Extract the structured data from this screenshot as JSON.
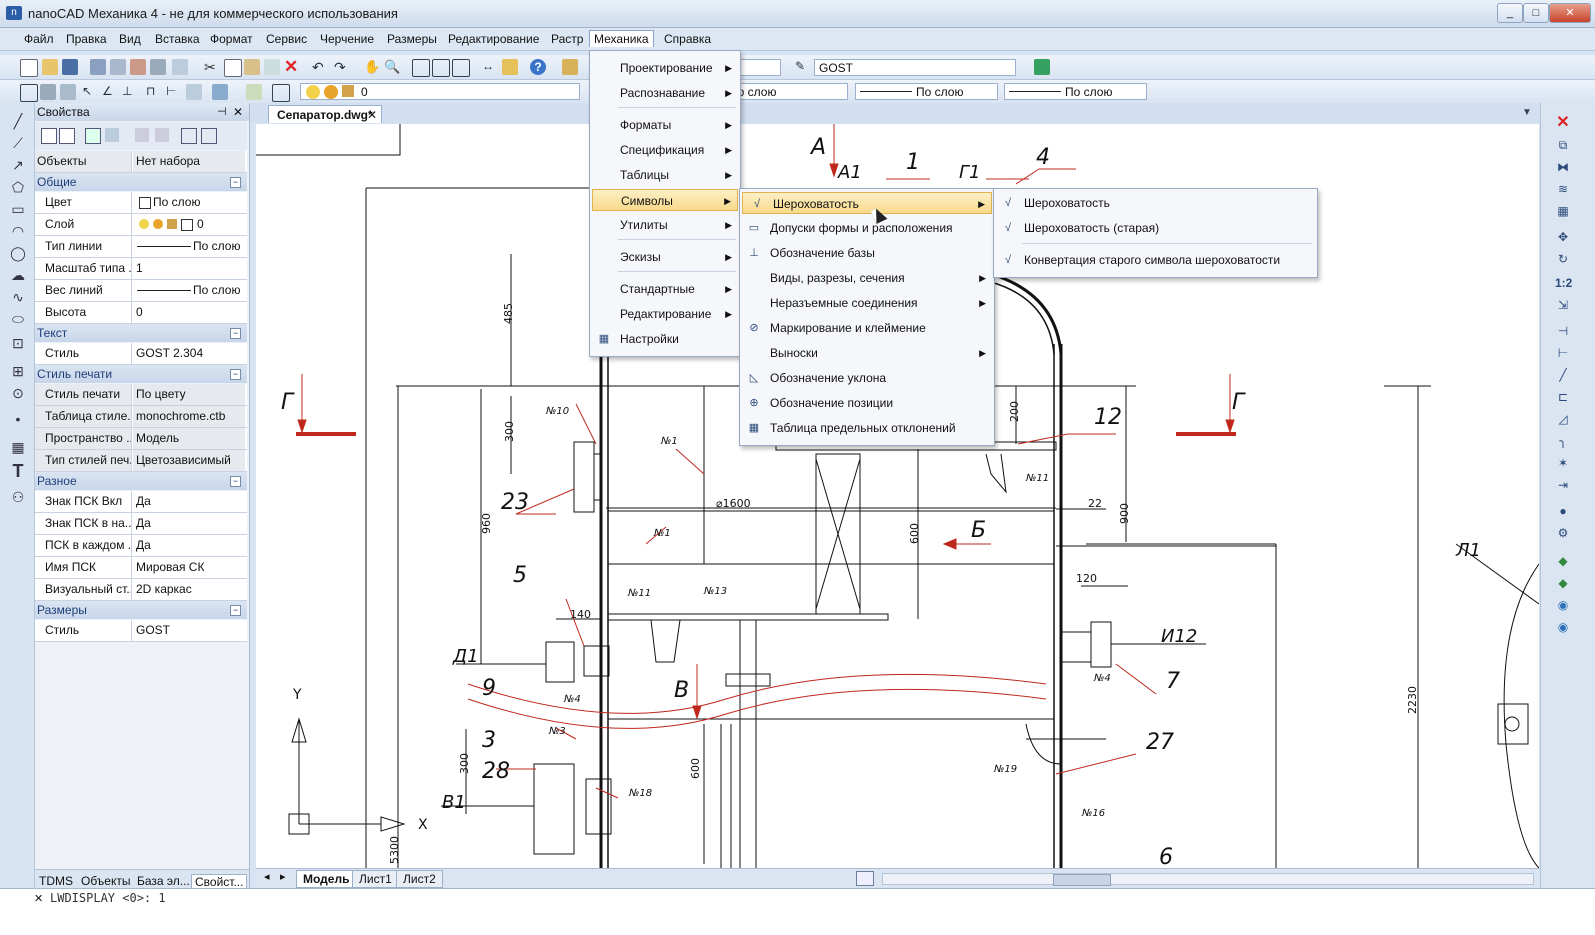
{
  "window": {
    "title": "nanoCAD Механика 4 - не для коммерческого использования"
  },
  "menubar": [
    "Файл",
    "Правка",
    "Вид",
    "Вставка",
    "Формат",
    "Сервис",
    "Черчение",
    "Размеры",
    "Редактирование",
    "Растр",
    "Механика",
    "Справка"
  ],
  "toolbar": {
    "text_style": "GOST",
    "layer_value": "0",
    "linetype": "По слою",
    "lineweight": "По слою",
    "color": "По слою",
    "linetype_left": "По слою"
  },
  "properties": {
    "title": "Свойства",
    "objects_key": "Объекты",
    "objects_val": "Нет набора",
    "general": {
      "header": "Общие",
      "rows": [
        {
          "k": "Цвет",
          "v": "По слою"
        },
        {
          "k": "Слой",
          "v": "0"
        },
        {
          "k": "Тип линии",
          "v": "По слою"
        },
        {
          "k": "Масштаб типа ...",
          "v": "1"
        },
        {
          "k": "Вес линий",
          "v": "По слою"
        },
        {
          "k": "Высота",
          "v": "0"
        }
      ]
    },
    "text": {
      "header": "Текст",
      "rows": [
        {
          "k": "Стиль",
          "v": "GOST 2.304"
        }
      ]
    },
    "print": {
      "header": "Стиль печати",
      "rows": [
        {
          "k": "Стиль печати",
          "v": "По цвету"
        },
        {
          "k": "Таблица стиле...",
          "v": "monochrome.ctb"
        },
        {
          "k": "Пространство ...",
          "v": "Модель"
        },
        {
          "k": "Тип стилей печ...",
          "v": "Цветозависимый"
        }
      ]
    },
    "misc": {
      "header": "Разное",
      "rows": [
        {
          "k": "Знак ПСК Вкл",
          "v": "Да"
        },
        {
          "k": "Знак ПСК в на...",
          "v": "Да"
        },
        {
          "k": "ПСК в каждом ...",
          "v": "Да"
        },
        {
          "k": "Имя ПСК",
          "v": "Мировая СК"
        },
        {
          "k": "Визуальный ст...",
          "v": "2D каркас"
        }
      ]
    },
    "dims": {
      "header": "Размеры",
      "rows": [
        {
          "k": "Стиль",
          "v": "GOST"
        }
      ]
    },
    "tabs": [
      "TDMS",
      "Объекты",
      "База эл...",
      "Свойст..."
    ]
  },
  "document": {
    "tab": "Сепаратор.dwg*"
  },
  "layout_tabs": [
    "Модель",
    "Лист1",
    "Лист2"
  ],
  "cmdline": "LWDISPLAY <0>: 1",
  "mech_menu": [
    {
      "label": "Проектирование",
      "sub": true
    },
    {
      "label": "Распознавание",
      "sub": true
    },
    {
      "label": "Форматы",
      "sub": true
    },
    {
      "label": "Спецификация",
      "sub": true
    },
    {
      "label": "Таблицы",
      "sub": true
    },
    {
      "label": "Символы",
      "sub": true
    },
    {
      "label": "Утилиты",
      "sub": true
    },
    {
      "label": "Эскизы",
      "sub": true
    },
    {
      "label": "Стандартные",
      "sub": true
    },
    {
      "label": "Редактирование",
      "sub": true
    },
    {
      "label": "Настройки",
      "sub": false
    }
  ],
  "symbols_menu": [
    {
      "label": "Шероховатость",
      "sub": true
    },
    {
      "label": "Допуски формы и расположения",
      "sub": false
    },
    {
      "label": "Обозначение базы",
      "sub": false
    },
    {
      "label": "Виды, разрезы, сечения",
      "sub": true
    },
    {
      "label": "Неразъемные соединения",
      "sub": true
    },
    {
      "label": "Маркирование и клеймение",
      "sub": false
    },
    {
      "label": "Выноски",
      "sub": true
    },
    {
      "label": "Обозначение уклона",
      "sub": false
    },
    {
      "label": "Обозначение позиции",
      "sub": false
    },
    {
      "label": "Таблица предельных отклонений",
      "sub": false
    }
  ],
  "roughness_menu": [
    {
      "label": "Шероховатость"
    },
    {
      "label": "Шероховатость (старая)"
    },
    {
      "label": "Конвертация старого символа шероховатости"
    }
  ],
  "drawing_labels": {
    "section_A": "А",
    "A1": "А1",
    "G1": "Г1",
    "n1": "1",
    "n4": "4",
    "G_left": "Г",
    "G_right": "Г",
    "n12": "12",
    "n23": "23",
    "n5": "5",
    "D1": "Д1",
    "n9": "9",
    "V": "В",
    "n3": "3",
    "n28": "28",
    "V1": "В1",
    "n7": "7",
    "I12": "И12",
    "n27": "27",
    "n6": "6",
    "L1": "Л1",
    "B": "Б",
    "d1600": "⌀1600",
    "dim485": "485",
    "dim300": "300",
    "dim960": "960",
    "dim140": "140",
    "dim600": "600",
    "dim120": "120",
    "dim900": "900",
    "dim200": "200",
    "dim22": "22",
    "dim2230": "2230",
    "dim5300": "5300",
    "dim300b": "300",
    "dim600b": "600",
    "N10": "№10",
    "N1a": "№1",
    "N1b": "№1",
    "N11a": "№11",
    "N13": "№13",
    "N4a": "№4",
    "N3": "№3",
    "N18": "№18",
    "N11b": "№11",
    "N4b": "№4",
    "N19": "№19",
    "N16": "№16",
    "axisY": "Y",
    "axisX": "X"
  }
}
